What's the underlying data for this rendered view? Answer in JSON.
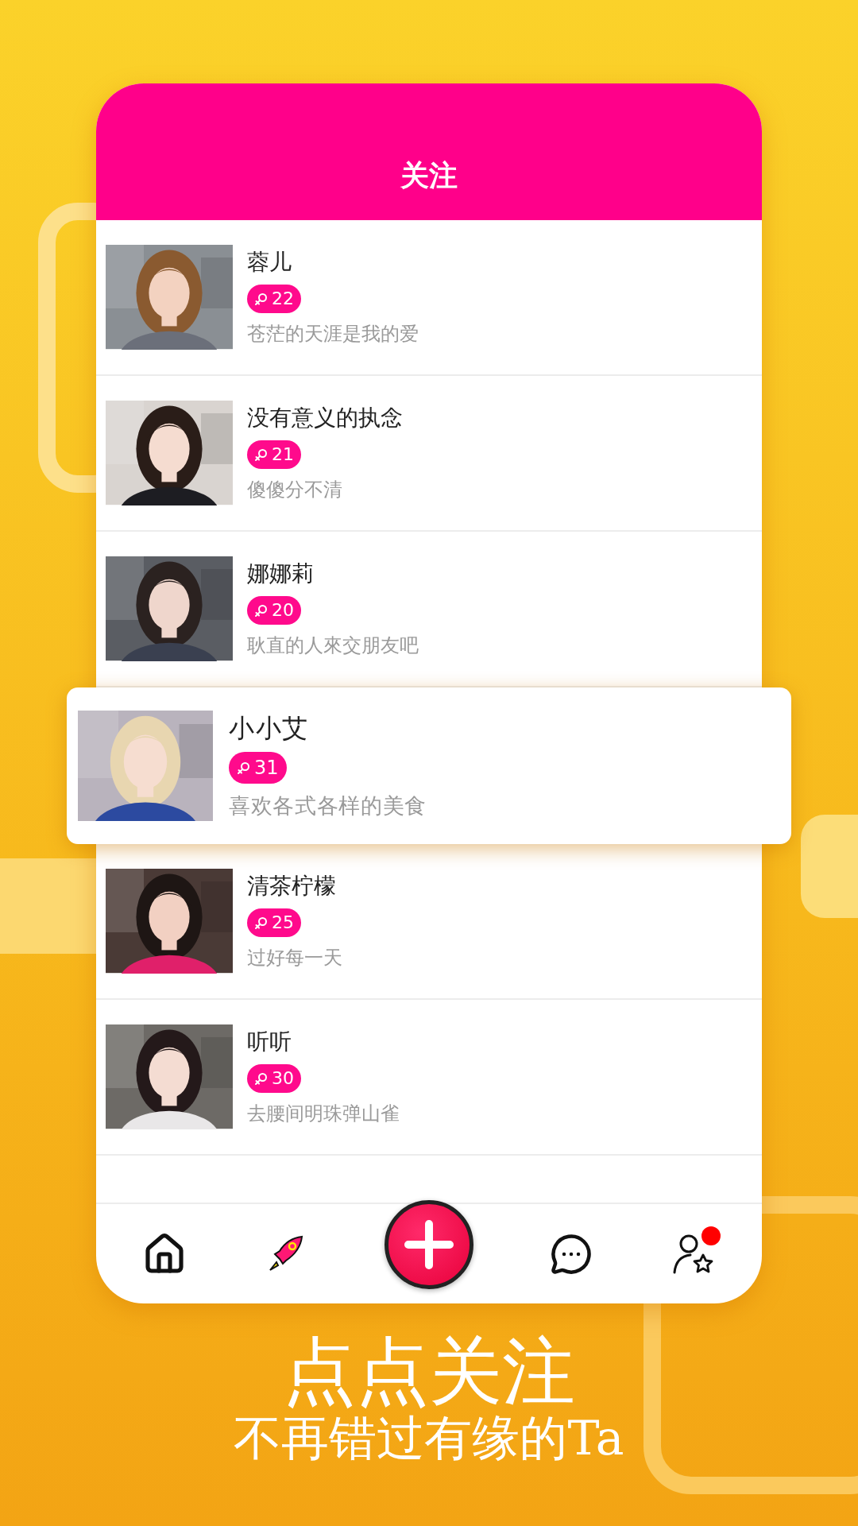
{
  "header": {
    "title": "关注"
  },
  "users": [
    {
      "name": "蓉儿",
      "age": "22",
      "bio": "苍茫的天涯是我的爱",
      "selected": false
    },
    {
      "name": "没有意义的执念",
      "age": "21",
      "bio": "傻傻分不清",
      "selected": false
    },
    {
      "name": "娜娜莉",
      "age": "20",
      "bio": "耿直的人來交朋友吧",
      "selected": false
    },
    {
      "name": "小小艾",
      "age": "31",
      "bio": "喜欢各式各样的美食",
      "selected": true
    },
    {
      "name": "清茶柠檬",
      "age": "25",
      "bio": "过好每一天",
      "selected": false
    },
    {
      "name": "听听",
      "age": "30",
      "bio": "去腰间明珠弹山雀",
      "selected": false
    }
  ],
  "nav": {
    "profile_notification": true
  },
  "slogan": {
    "title": "点点关注",
    "subtitle": "不再错过有缘的Ta"
  }
}
